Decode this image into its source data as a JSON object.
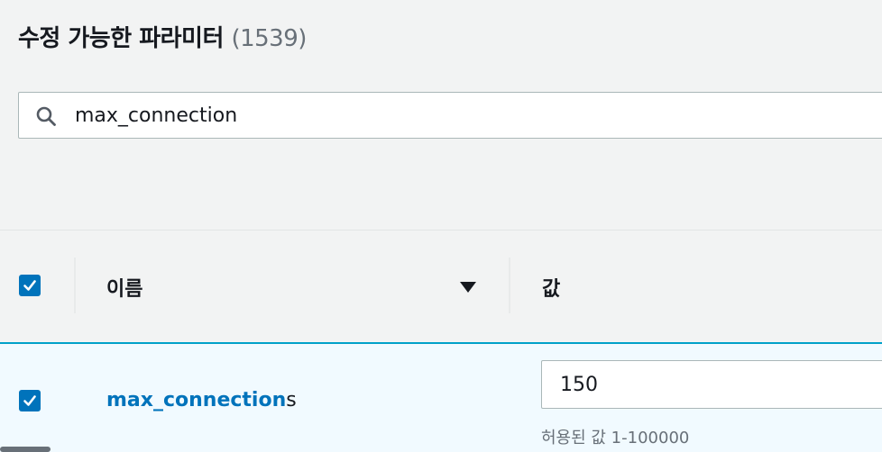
{
  "header": {
    "title": "수정 가능한 파라미터",
    "count": "(1539)"
  },
  "search": {
    "value": "max_connection",
    "icon": "search-icon"
  },
  "table": {
    "columns": [
      {
        "label": "이름",
        "sort": "descending"
      },
      {
        "label": "값"
      }
    ],
    "header_checkbox_checked": true,
    "rows": [
      {
        "checked": true,
        "name_match": "max_connection",
        "name_rest": "s",
        "value": "150",
        "constraint": "허용된 값 1-100000"
      }
    ]
  },
  "colors": {
    "accent": "#0073bb",
    "selected_row_bg": "#f1faff",
    "selected_row_border": "#00a1c9",
    "page_bg": "#f2f3f3"
  }
}
